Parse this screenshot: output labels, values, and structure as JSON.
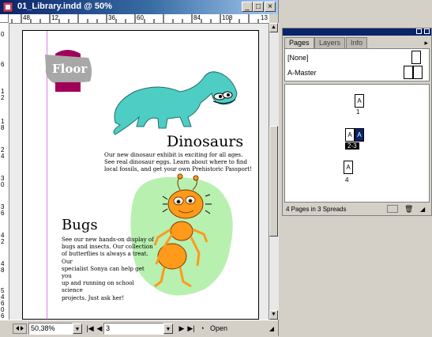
{
  "window": {
    "title": "01_Library.indd @ 50%",
    "buttons": {
      "minimize": "_",
      "maximize": "□",
      "close": "×"
    }
  },
  "ruler": {
    "top_ticks": [
      "48",
      "12",
      "36",
      "60",
      "84",
      "108",
      "13"
    ],
    "left_ticks": [
      "0",
      "6",
      "1",
      "2",
      "1",
      "8",
      "2",
      "4",
      "3",
      "0",
      "3",
      "6",
      "4",
      "2",
      "4",
      "8",
      "5",
      "4",
      "6",
      "0",
      "6"
    ]
  },
  "document": {
    "floor_heading": "Floor",
    "dino_heading": "Dinosaurs",
    "dino_text": "Our new dinosaur exhibit is exciting for all ages.\nSee real dinosaur eggs. Learn about where to find\nlocal fossils, and get your own Prehistoric Passport!",
    "bugs_heading": "Bugs",
    "bugs_text": "See our new hands-on display of\nbugs and insects. Our collection\nof butterflies is always a treat. Our\nspecialist Sonya can help get you\nup and running on school science\nprojects. Just ask her!",
    "colors": {
      "floor_badge": "#a8a8a8",
      "floor_accent": "#a0005a",
      "dino": "#4ecdc4",
      "bug_bg": "#b8f0b0",
      "bug": "#ff9a1a"
    }
  },
  "statusbar": {
    "zoom": "50,38%",
    "page": "3",
    "open_label": "Open"
  },
  "panel": {
    "tabs": [
      "Pages",
      "Layers",
      "Info"
    ],
    "active_tab": "Pages",
    "masters": [
      "[None]",
      "A-Master"
    ],
    "pages": [
      {
        "label": "1",
        "letter": "A"
      },
      {
        "label": "2-3",
        "letter": "A"
      },
      {
        "label": "4",
        "letter": "A"
      }
    ],
    "status": "4 Pages in 3 Spreads"
  }
}
